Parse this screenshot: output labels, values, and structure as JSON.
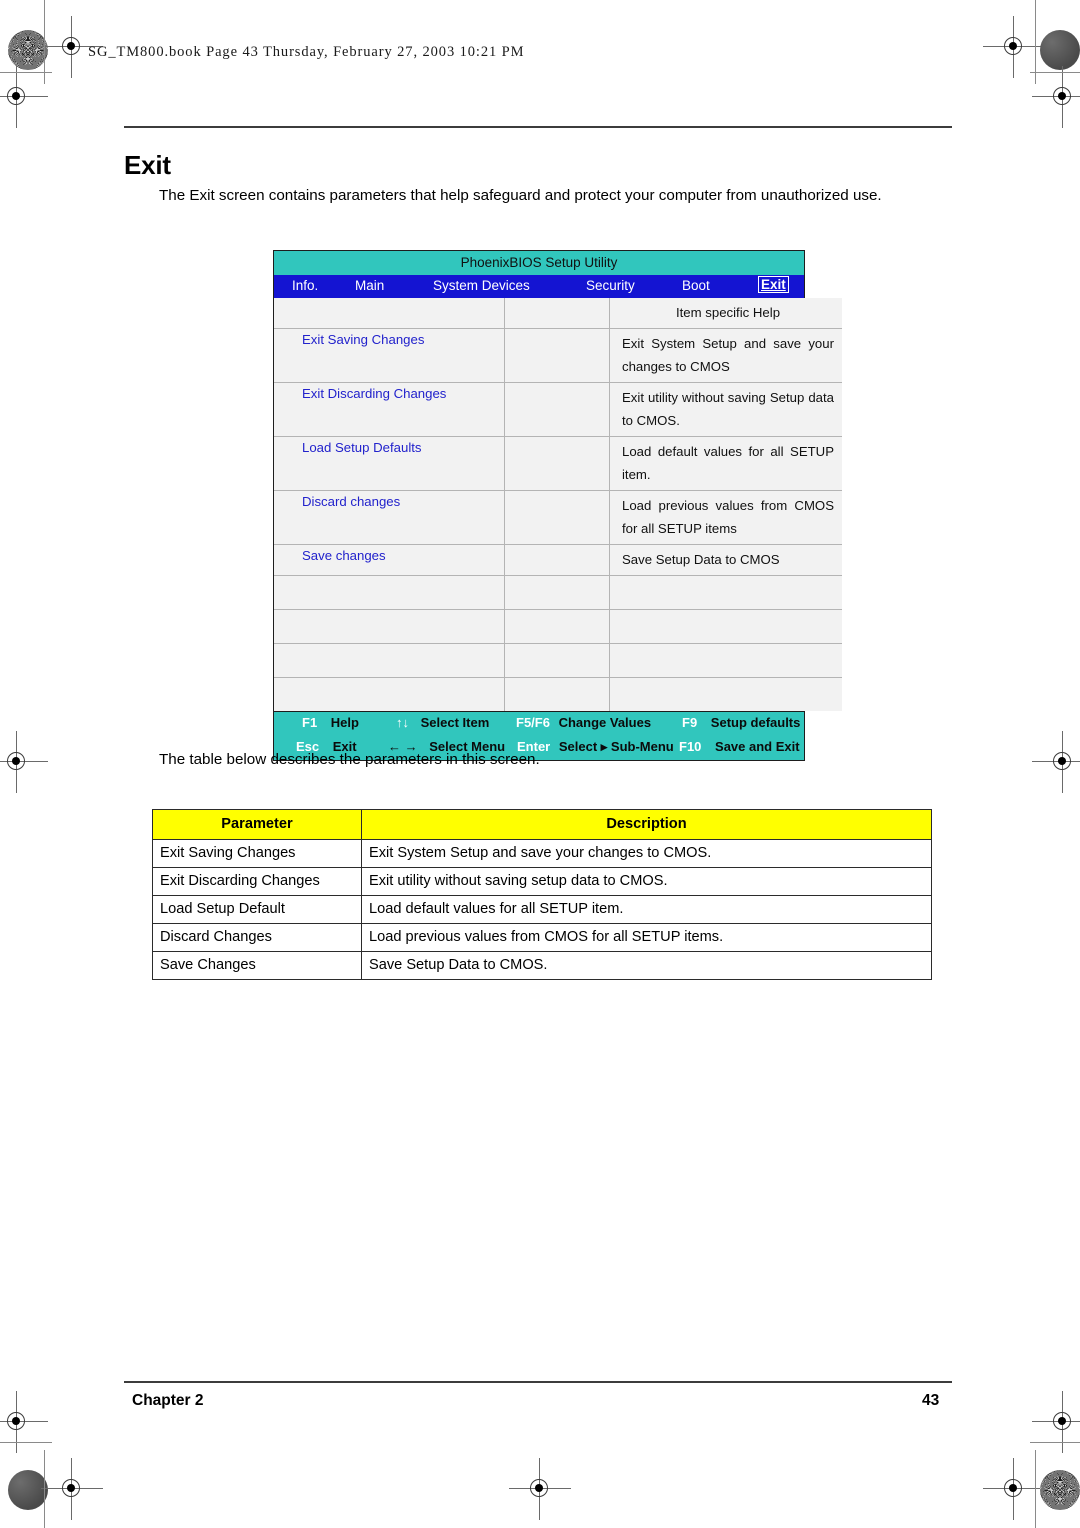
{
  "running_header": "SG_TM800.book  Page 43  Thursday, February 27, 2003  10:21 PM",
  "heading": "Exit",
  "intro": "The Exit screen contains parameters that help safeguard and protect your computer from unauthorized use.",
  "table_lead": "The table below describes the parameters in this screen.",
  "bios": {
    "title": "PhoenixBIOS Setup Utility",
    "tabs": [
      {
        "label": "Info.",
        "selected": false
      },
      {
        "label": "Main",
        "selected": false
      },
      {
        "label": "System Devices",
        "selected": false
      },
      {
        "label": "Security",
        "selected": false
      },
      {
        "label": "Boot",
        "selected": false
      },
      {
        "label": "Exit",
        "selected": true
      }
    ],
    "help_column_title": "Item specific Help",
    "rows": [
      {
        "item": "Exit Saving Changes",
        "help": "Exit System Setup and save your changes to CMOS"
      },
      {
        "item": "Exit Discarding Changes",
        "help": "Exit utility without saving Setup data to CMOS."
      },
      {
        "item": "Load Setup Defaults",
        "help": "Load default values for all SETUP item."
      },
      {
        "item": "Discard changes",
        "help": "Load previous values from CMOS for all SETUP items"
      },
      {
        "item": "Save changes",
        "help": "Save Setup Data to CMOS"
      }
    ],
    "blank_row_count": 4,
    "footer": {
      "row1": [
        {
          "key": "F1",
          "text": "Help"
        },
        {
          "key": "↑↓",
          "text": "Select Item",
          "key_style": "arrow-white"
        },
        {
          "key": "F5/F6",
          "text": "Change Values"
        },
        {
          "key": "F9",
          "text": "Setup defaults"
        }
      ],
      "row2": [
        {
          "key": "Esc",
          "text": "Exit"
        },
        {
          "key": "← →",
          "text": "Select Menu",
          "key_style": "arrow-black"
        },
        {
          "key": "Enter",
          "text": "Select ▸ Sub-Menu"
        },
        {
          "key": "F10",
          "text": "Save and Exit"
        }
      ]
    },
    "colors": {
      "title_bar": "#31c6bd",
      "menu_bar": "#1414d2",
      "body": "#f2f2f2",
      "item_text": "#2222cc",
      "footer_bar": "#31c6bd"
    }
  },
  "parameter_table": {
    "headers": [
      "Parameter",
      "Description"
    ],
    "header_background": "#ffff00",
    "rows": [
      [
        "Exit Saving Changes",
        "Exit System Setup and save your changes to CMOS."
      ],
      [
        "Exit Discarding Changes",
        "Exit utility without saving setup data to CMOS."
      ],
      [
        "Load Setup Default",
        "Load default values for all SETUP item."
      ],
      [
        "Discard Changes",
        "Load previous values from CMOS for all SETUP items."
      ],
      [
        "Save Changes",
        "Save Setup Data to CMOS."
      ]
    ]
  },
  "page_footer": {
    "chapter": "Chapter 2",
    "page_number": "43"
  }
}
